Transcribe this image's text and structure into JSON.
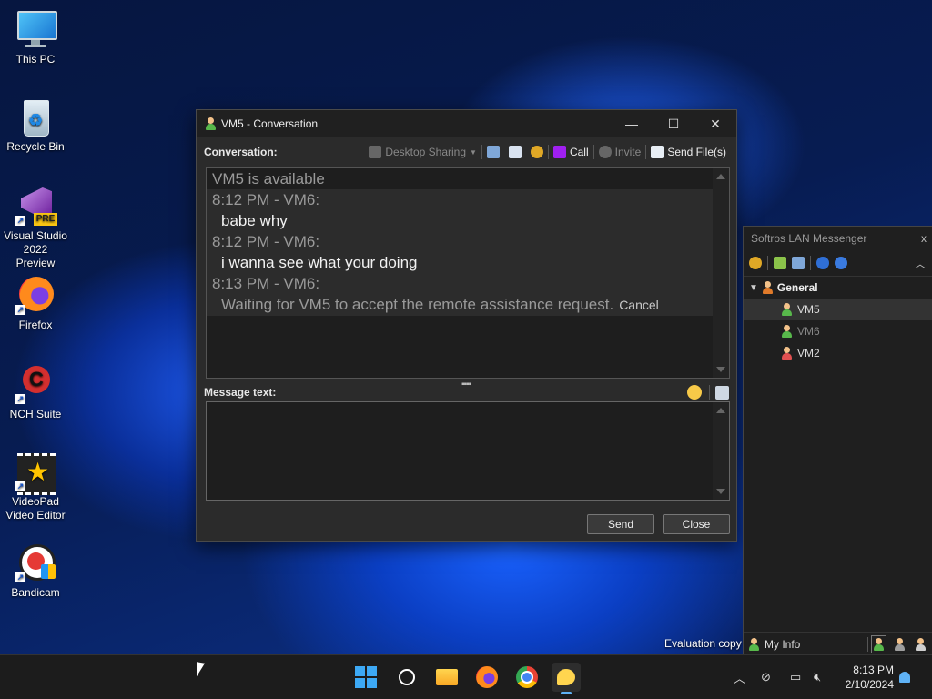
{
  "desktop": {
    "icons": [
      {
        "label": "This PC",
        "icon": "monitor-icon"
      },
      {
        "label": "Recycle Bin",
        "icon": "recycle-bin-icon"
      },
      {
        "label": "Visual Studio 2022 Preview",
        "badge": "PRE",
        "icon": "visual-studio-icon"
      },
      {
        "label": "Firefox",
        "icon": "firefox-icon"
      },
      {
        "label": "NCH Suite",
        "icon": "nch-suite-icon"
      },
      {
        "label": "VideoPad Video Editor",
        "icon": "videopad-icon"
      },
      {
        "label": "Bandicam",
        "icon": "bandicam-icon"
      }
    ],
    "evaluation_text": "Evaluation copy"
  },
  "conversation": {
    "title": "VM5 - Conversation",
    "toolbar": {
      "label": "Conversation:",
      "desktop_sharing": "Desktop Sharing",
      "call": "Call",
      "invite": "Invite",
      "send_files": "Send File(s)"
    },
    "history": {
      "status_line": "VM5 is available",
      "messages": [
        {
          "header": "8:12 PM - VM6:",
          "text": "babe why"
        },
        {
          "header": "8:12 PM - VM6:",
          "text": "i wanna see what your doing"
        },
        {
          "header": "8:13 PM - VM6:",
          "text": "Waiting for VM5 to accept the remote assistance request."
        }
      ],
      "cancel_link": "Cancel"
    },
    "message_label": "Message text:",
    "message_value": "",
    "send_button": "Send",
    "close_button": "Close"
  },
  "messenger": {
    "title": "Softros LAN Messenger",
    "close": "x",
    "group": "General",
    "users": [
      {
        "name": "VM5",
        "status_color": "#58b84b"
      },
      {
        "name": "VM6",
        "status_color": "#58b84b"
      },
      {
        "name": "VM2",
        "status_color": "#e05050"
      }
    ],
    "my_info": "My Info"
  },
  "taskbar": {
    "apps": [
      "start-icon",
      "search-icon",
      "file-explorer-icon",
      "firefox-icon",
      "chrome-icon",
      "messenger-icon"
    ],
    "time": "8:13 PM",
    "date": "2/10/2024"
  }
}
